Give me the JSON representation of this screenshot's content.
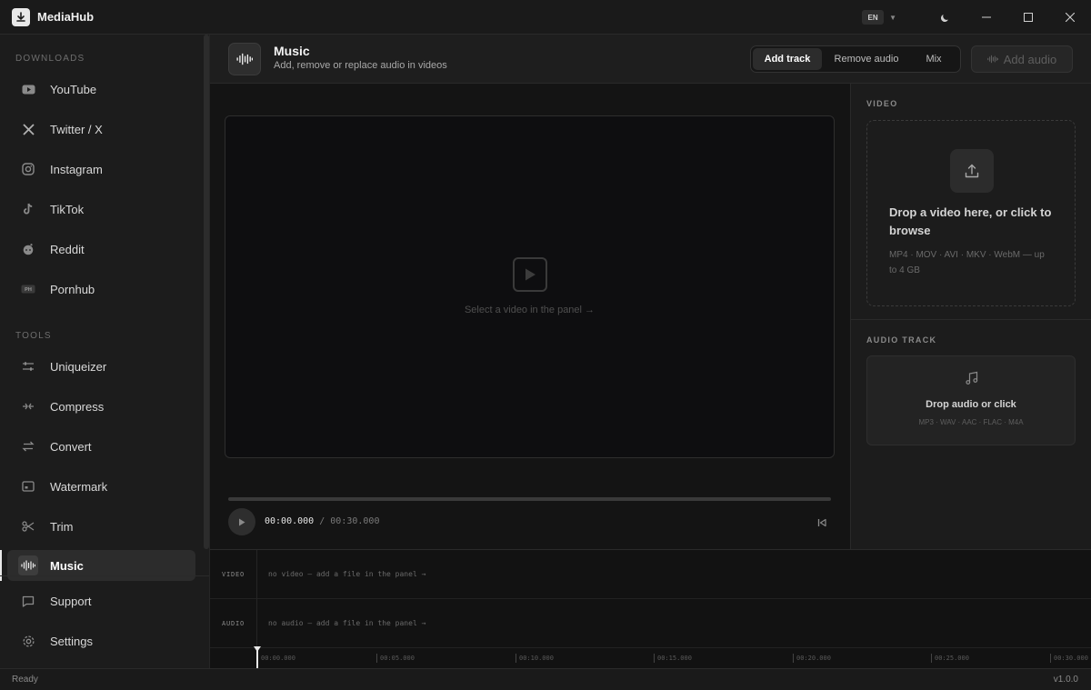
{
  "app": {
    "title": "MediaHub",
    "language": "EN"
  },
  "sidebar": {
    "downloads_label": "DOWNLOADS",
    "tools_label": "TOOLS",
    "downloads": [
      {
        "label": "YouTube",
        "icon": "youtube-icon"
      },
      {
        "label": "Twitter / X",
        "icon": "x-icon"
      },
      {
        "label": "Instagram",
        "icon": "instagram-icon"
      },
      {
        "label": "TikTok",
        "icon": "tiktok-icon"
      },
      {
        "label": "Reddit",
        "icon": "reddit-icon"
      },
      {
        "label": "Pornhub",
        "icon": "ph-icon"
      }
    ],
    "tools": [
      {
        "label": "Uniqueizer",
        "icon": "sliders-icon"
      },
      {
        "label": "Compress",
        "icon": "compress-icon"
      },
      {
        "label": "Convert",
        "icon": "convert-icon"
      },
      {
        "label": "Watermark",
        "icon": "watermark-icon"
      },
      {
        "label": "Trim",
        "icon": "scissors-icon"
      },
      {
        "label": "Music",
        "icon": "waveform-icon",
        "active": true
      }
    ],
    "bottom": [
      {
        "label": "Support",
        "icon": "chat-icon"
      },
      {
        "label": "Settings",
        "icon": "gear-icon"
      }
    ]
  },
  "header": {
    "title": "Music",
    "subtitle": "Add, remove or replace audio in videos",
    "modes": [
      "Add track",
      "Remove audio",
      "Mix"
    ],
    "active_mode": "Add track",
    "action_label": "Add audio"
  },
  "preview": {
    "hint": "Select a video in the panel →",
    "current_time": "00:00.000",
    "separator": "/",
    "total_time": "00:30.000"
  },
  "right_panel": {
    "video_label": "VIDEO",
    "video_drop_title": "Drop a video here, or click to browse",
    "video_formats": "MP4 · MOV · AVI · MKV · WebM — up to 4 GB",
    "audio_label": "AUDIO TRACK",
    "audio_drop_title": "Drop audio or click",
    "audio_formats": "MP3 · WAV · AAC · FLAC · M4A"
  },
  "timeline": {
    "video_label": "VIDEO",
    "video_empty": "no video — add a file in the panel →",
    "audio_label": "AUDIO",
    "audio_empty": "no audio — add a file in the panel →",
    "ticks": [
      "00:00.000",
      "00:05.000",
      "00:10.000",
      "00:15.000",
      "00:20.000",
      "00:25.000",
      "00:30.000"
    ]
  },
  "status": {
    "left": "Ready",
    "version": "v1.0.0"
  },
  "colors": {
    "background": "#1c1c1c",
    "accent": "#e8e8e8",
    "video_bg": "#0e0e10"
  }
}
